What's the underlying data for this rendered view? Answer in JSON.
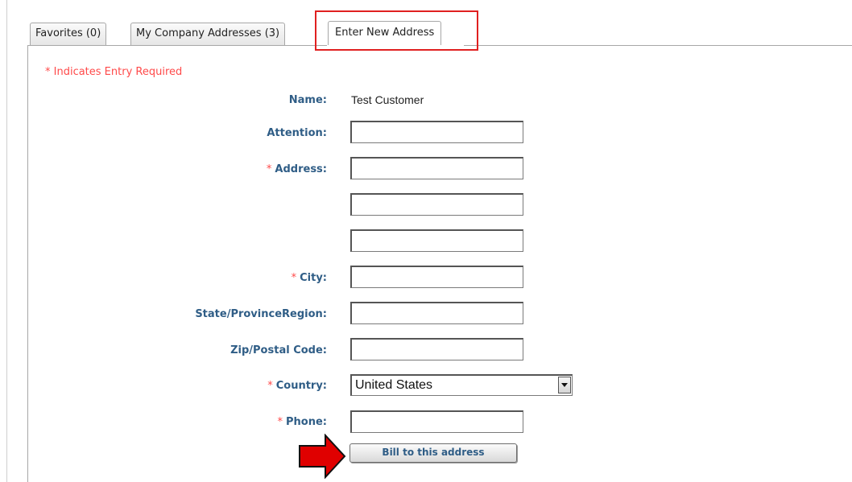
{
  "tabs": [
    {
      "label": "Favorites (0)"
    },
    {
      "label": "My Company Addresses (3)"
    },
    {
      "label": "Enter New Address"
    }
  ],
  "required_note": "* Indicates Entry Required",
  "form": {
    "name_label": "Name:",
    "name_value": "Test Customer",
    "attention_label": "Attention:",
    "address_label": "Address:",
    "city_label": "City:",
    "state_label": "State/ProvinceRegion:",
    "zip_label": "Zip/Postal Code:",
    "country_label": "Country:",
    "country_value": "United States",
    "phone_label": "Phone:",
    "required_marker": "*",
    "attention_value": "",
    "address1_value": "",
    "address2_value": "",
    "address3_value": "",
    "city_value": "",
    "state_value": "",
    "zip_value": "",
    "phone_value": ""
  },
  "submit_button": "Bill to this address",
  "colors": {
    "label": "#2f5d86",
    "required": "#ff4a4a",
    "highlight": "#e02020",
    "arrow": "#e00000"
  },
  "icons": {
    "select_arrow": "chevron-down-icon",
    "pointer": "right-arrow-icon"
  }
}
